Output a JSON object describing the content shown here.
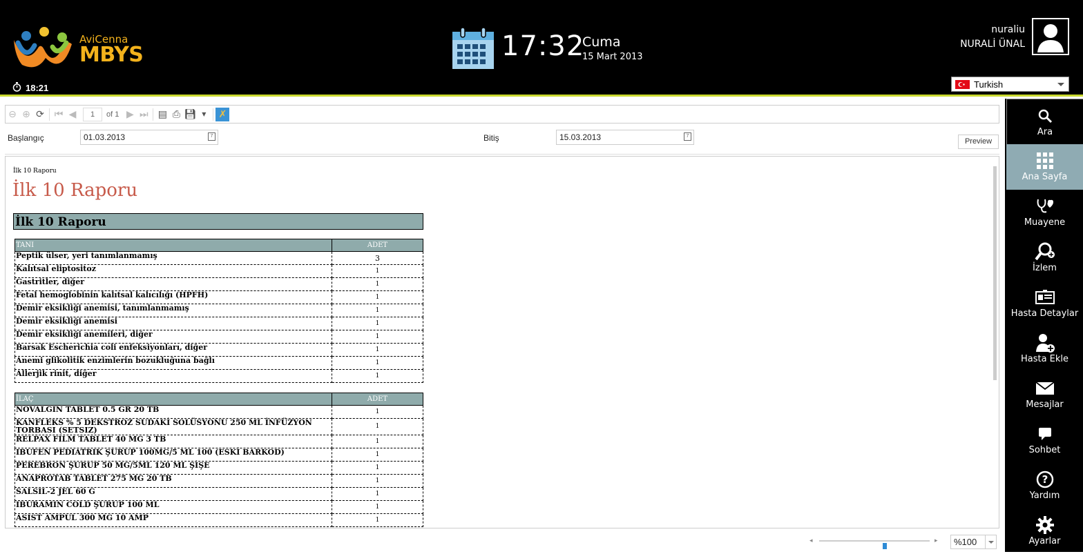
{
  "header": {
    "logo_small": "AviCenna",
    "logo_big": "MBYS",
    "timer": "18:21",
    "clock": "17:32",
    "day": "Cuma",
    "date": "15 Mart 2013",
    "user_login": "nuraliu",
    "user_name": "NURALİ ÜNAL",
    "language": "Turkish"
  },
  "toolbar": {
    "page": "1",
    "page_of": "of 1"
  },
  "params": {
    "start_label": "Başlangıç",
    "start_value": "01.03.2013",
    "end_label": "Bitiş",
    "end_value": "15.03.2013",
    "preview_label": "Preview"
  },
  "report": {
    "small_title": "İlk 10 Raporu",
    "title": "İlk 10 Raporu",
    "band": "İlk 10 Raporu",
    "diag_header": [
      "TANI",
      "ADET"
    ],
    "diagnoses": [
      {
        "name": "Peptik ülser, yeri tanımlanmamış",
        "count": "3"
      },
      {
        "name": "Kalıtsal eliptositoz",
        "count": "1"
      },
      {
        "name": "Gastritler, diğer",
        "count": "1"
      },
      {
        "name": "Fetal hemoglobinin kalıtsal kalıcılığı (HPFH)",
        "count": "1"
      },
      {
        "name": "Demir eksikliği anemisi, tanımlanmamış",
        "count": "1"
      },
      {
        "name": "Demir eksikliği anemisi",
        "count": "1"
      },
      {
        "name": "Demir eksikliği anemileri, diğer",
        "count": "1"
      },
      {
        "name": "Barsak Escherichia coli enfeksiyonları, diğer",
        "count": "1"
      },
      {
        "name": "Anemi glikolitik enzimlerin bozukluğuna bağlı",
        "count": "1"
      },
      {
        "name": "Allerjik rinit, diğer",
        "count": "1"
      }
    ],
    "drug_header": [
      "İLAÇ",
      "ADET"
    ],
    "drugs": [
      {
        "name": "NOVALGIN TABLET 0.5 GR 20 TB",
        "count": "1"
      },
      {
        "name": "KANFLEKS % 5 DEKSTROZ SUDAKİ SOLÜSYONU 250 ML İNFÜZYON TORBASI (SETSIZ)",
        "count": "1"
      },
      {
        "name": "RELPAX FILM TABLET 40 MG 3 TB",
        "count": "1"
      },
      {
        "name": "IBUFEN PEDIATRIK ŞURUP 100MG/5 ML 100 (ESKİ BARKOD)",
        "count": "1"
      },
      {
        "name": "PEREBRON ŞURUP 50 MG/5ML 120 ML ŞİŞE",
        "count": "1"
      },
      {
        "name": "ANAPROTAB TABLET 275 MG 20 TB",
        "count": "1"
      },
      {
        "name": "SALSIL-2 JEL 60 G",
        "count": "1"
      },
      {
        "name": "IBURAMIN COLD ŞURUP 100 ML",
        "count": "1"
      },
      {
        "name": "ASIST AMPUL 300 MG 10 AMP",
        "count": "1"
      }
    ]
  },
  "sidebar": {
    "items": [
      {
        "label": "Ara",
        "icon": "search-icon"
      },
      {
        "label": "Ana Sayfa",
        "icon": "grid-icon"
      },
      {
        "label": "Muayene",
        "icon": "stethoscope-heart-icon"
      },
      {
        "label": "İzlem",
        "icon": "magnifier-plus-icon"
      },
      {
        "label": "Hasta Detaylar",
        "icon": "id-card-icon"
      },
      {
        "label": "Hasta Ekle",
        "icon": "user-add-icon"
      },
      {
        "label": "Mesajlar",
        "icon": "envelope-icon"
      },
      {
        "label": "Sohbet",
        "icon": "chat-icon"
      },
      {
        "label": "Yardım",
        "icon": "help-icon"
      },
      {
        "label": "Ayarlar",
        "icon": "gear-icon"
      }
    ]
  },
  "zoom": {
    "value": "%100",
    "level_fraction": 0.6
  },
  "colors": {
    "header_bg": "#000000",
    "accent_line": "#c9d92e",
    "logo": "#f3b21c",
    "sidebar_active": "#8fabb3",
    "report_title": "#c75a4a",
    "table_header": "#8fabab"
  }
}
